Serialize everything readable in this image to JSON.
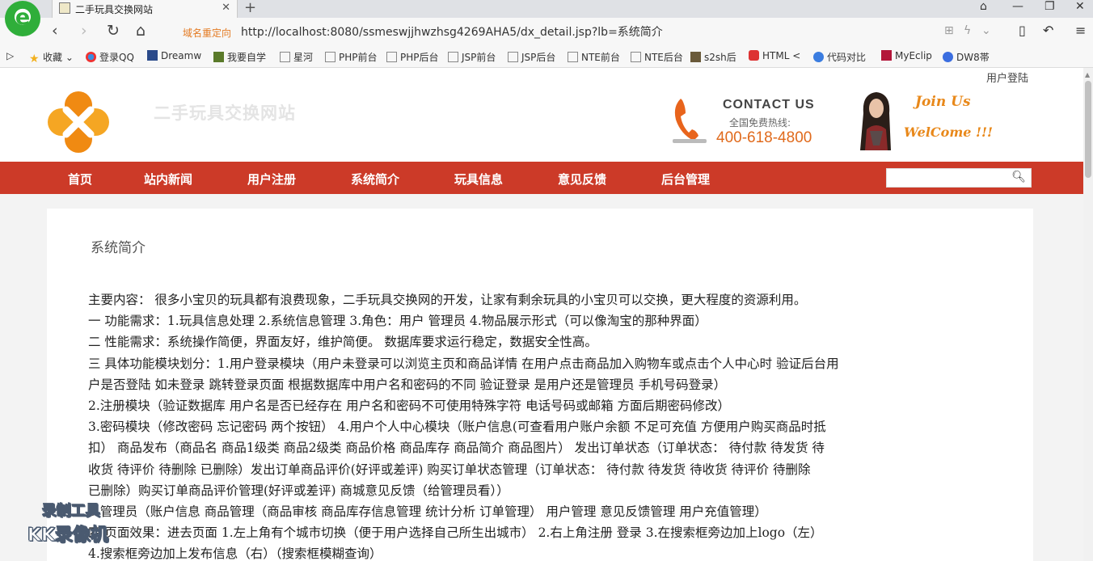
{
  "browser": {
    "tab_title": "二手玩具交换网站",
    "redirect_label": "域名重定向",
    "url": "http://localhost:8080/ssmeswjjhwzhsg4269AHA5/dx_detail.jsp?lb=系统简介",
    "bookmarks": [
      "收藏",
      "登录QQ",
      "Dreamw",
      "我要自学",
      "星河",
      "PHP前台",
      "PHP后台",
      "JSP前台",
      "JSP后台",
      "NTE前台",
      "NTE后台",
      "s2sh后",
      "HTML <",
      "代码对比",
      "MyEclip",
      "DW8帯"
    ]
  },
  "header": {
    "user_login": "用户登陆",
    "site_name": "二手玩具交换网站",
    "contact_title": "CONTACT US",
    "hotline_label": "全国免费热线:",
    "hotline_number": "400-618-4800",
    "join_us": "Join Us",
    "welcome": "WelCome !!!"
  },
  "nav": {
    "items": [
      "首页",
      "站内新闻",
      "用户注册",
      "系统简介",
      "玩具信息",
      "意见反馈",
      "后台管理"
    ],
    "search_placeholder": ""
  },
  "content": {
    "section_title": "系统简介",
    "lines": [
      "主要内容：  很多小宝贝的玩具都有浪费现象，二手玩具交换网的开发，让家有剩余玩具的小宝贝可以交换，更大程度的资源利用。",
      "一 功能需求：1.玩具信息处理  2.系统信息管理  3.角色：用户 管理员 4.物品展示形式（可以像淘宝的那种界面）",
      "二 性能需求：系统操作简便，界面友好，维护简便。 数据库要求运行稳定，数据安全性高。",
      "三 具体功能模块划分：1.用户登录模块（用户未登录可以浏览主页和商品详情 在用户点击商品加入购物车或点击个人中心时 验证后台用",
      "户是否登陆 如未登录 跳转登录页面 根据数据库中用户名和密码的不同 验证登录 是用户还是管理员  手机号码登录）",
      "2.注册模块（验证数据库 用户名是否已经存在 用户名和密码不可使用特殊字符 电话号码或邮箱 方面后期密码修改）",
      "3.密码模块（修改密码 忘记密码 两个按钮） 4.用户个人中心模块（账户信息(可查看用户账户余额 不足可充值 方便用户购买商品时抵",
      "扣） 商品发布（商品名 商品1级类 商品2级类 商品价格 商品库存 商品简介 商品图片） 发出订单状态（订单状态：  待付款 待发货 待",
      "收货 待评价 待删除 已删除）发出订单商品评价(好评或差评)  购买订单状态管理（订单状态：  待付款 待发货 待收货 待评价 待删除",
      "已删除）购买订单商品评价管理(好评或差评) 商城意见反馈（给管理员看））",
      "5.管理员（账户信息 商品管理（商品审核 商品库存信息管理 统计分析 订单管理） 用户管理 意见反馈管理  用户充值管理）",
      "四 页面效果：进去页面 1.左上角有个城市切换（便于用户选择自己所生出城市） 2.右上角注册 登录  3.在搜索框旁边加上logo（左）",
      "4.搜索框旁边加上发布信息（右）（搜索框模糊查询）"
    ]
  },
  "watermark": {
    "line1": "录制工具",
    "line2": "KK录像机"
  },
  "colors": {
    "nav_red": "#cc3a28",
    "accent_orange": "#e06a1c",
    "join_orange": "#e8881a"
  }
}
